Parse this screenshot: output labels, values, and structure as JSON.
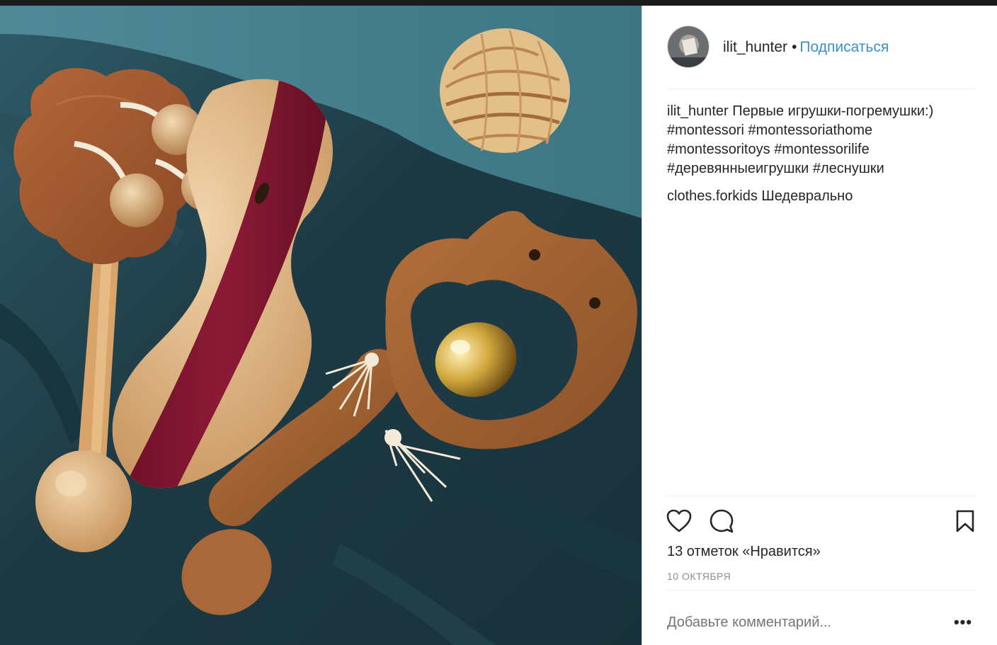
{
  "post": {
    "username": "ilit_hunter",
    "separator_dot": "•",
    "follow_label": "Подписаться",
    "caption_user": "ilit_hunter",
    "caption_text": "Первые игрушки-погремушки:)",
    "hashtags": [
      "#montessori",
      "#montessoriathome",
      "#montessoritoys",
      "#montessorilife",
      "#деревянныеигрушки",
      "#леснушки"
    ],
    "comment": {
      "user": "clothes.forkids",
      "text": "Шедеврально"
    },
    "likes_text": "13 отметок «Нравится»",
    "date": "10 ОКТЯБРЯ",
    "add_comment_placeholder": "Добавьте комментарий...",
    "more_icon": "more-horizontal-icon"
  },
  "icons": [
    "heart-icon",
    "comment-icon",
    "bookmark-icon",
    "more-horizontal-icon"
  ],
  "colors": {
    "link": "#3a8fcc",
    "text": "#262626",
    "muted": "#8e8e8e",
    "border": "#efefef"
  }
}
